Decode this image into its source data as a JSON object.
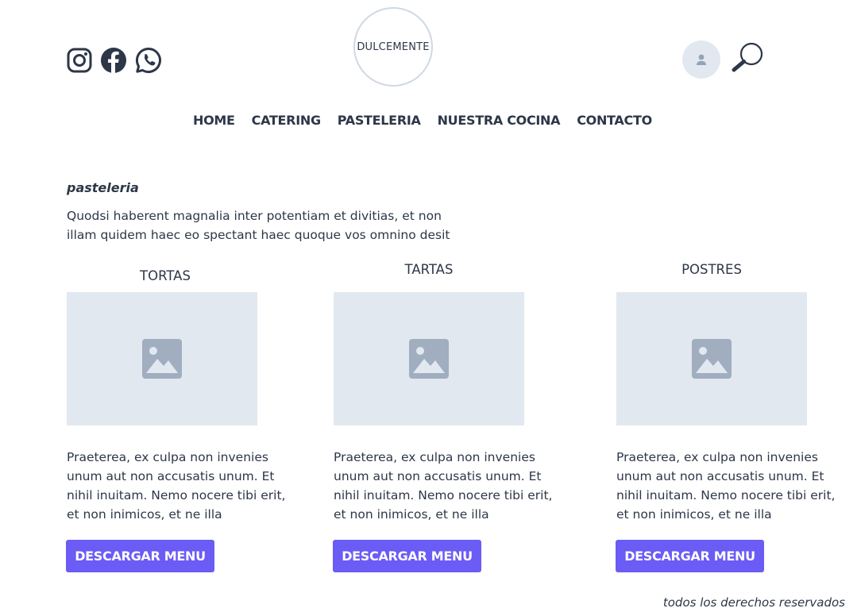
{
  "header": {
    "logo_text": "DULCEMENTE",
    "social": [
      "instagram-icon",
      "facebook-icon",
      "whatsapp-icon"
    ]
  },
  "nav": {
    "items": [
      "HOME",
      "CATERING",
      "PASTELERIA",
      "NUESTRA COCINA",
      "CONTACTO"
    ]
  },
  "main": {
    "section_label": "pasteleria",
    "intro": "Quodsi haberent magnalia inter potentiam et divitias, et non illam quidem haec eo spectant haec quoque vos omnino desit",
    "cards": [
      {
        "title": "TORTAS",
        "description": "Praeterea, ex culpa non invenies unum aut non accusatis unum. Et nihil inuitam. Nemo nocere tibi erit, et non inimicos, et ne illa",
        "button": "DESCARGAR MENU"
      },
      {
        "title": "TARTAS",
        "description": "Praeterea, ex culpa non invenies unum aut non accusatis unum. Et nihil inuitam. Nemo nocere tibi erit, et non inimicos, et ne illa",
        "button": "DESCARGAR MENU"
      },
      {
        "title": "POSTRES",
        "description": "Praeterea, ex culpa non invenies unum aut non accusatis unum. Et nihil inuitam. Nemo nocere tibi erit, et non inimicos, et ne illa",
        "button": "DESCARGAR MENU"
      }
    ]
  },
  "footer": {
    "text": "todos los derechos reservados"
  },
  "colors": {
    "accent": "#6b5cf6",
    "placeholder": "#e2e8f0",
    "text": "#2d3748"
  }
}
